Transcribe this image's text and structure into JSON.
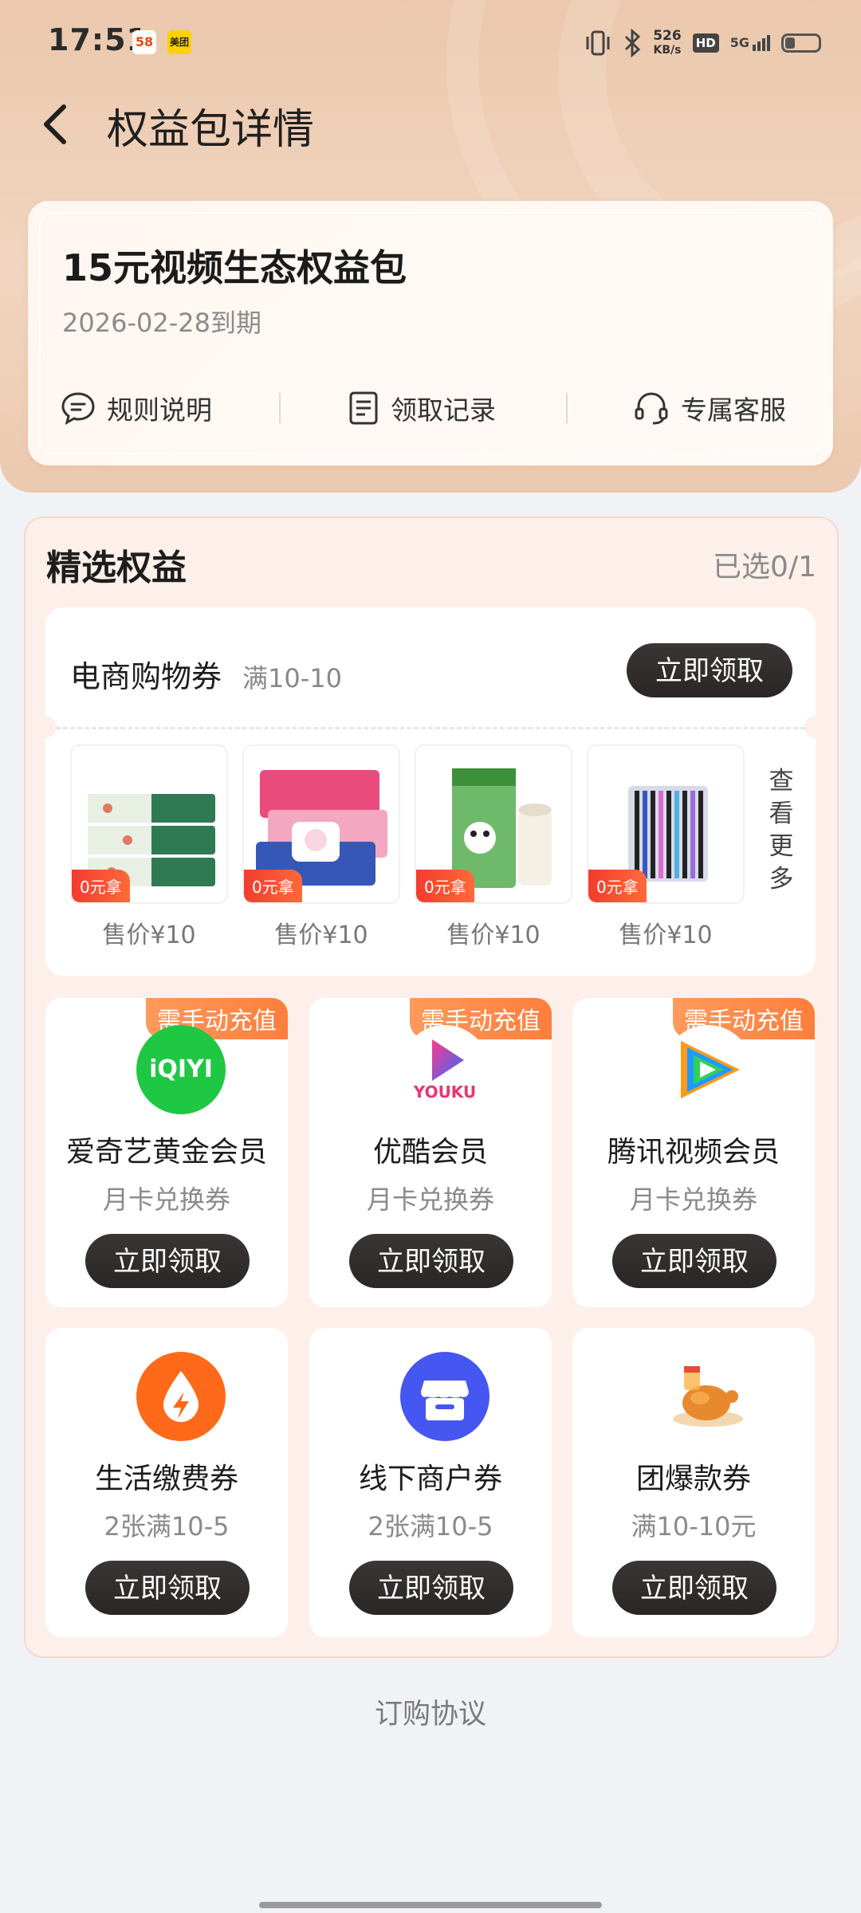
{
  "status_bar": {
    "time": "17:51",
    "app_58": "58",
    "app_meituan": "美团",
    "net_speed_value": "526",
    "net_speed_unit": "KB/s",
    "hd": "HD",
    "signal": "5G",
    "battery_level": 0.3
  },
  "header": {
    "title": "权益包详情"
  },
  "package": {
    "name": "15元视频生态权益包",
    "expiry": "2026-02-28到期",
    "actions": [
      "规则说明",
      "领取记录",
      "专属客服"
    ]
  },
  "selected": {
    "title": "精选权益",
    "count": "已选0/1"
  },
  "ecommerce": {
    "title": "电商购物券",
    "condition": "满10-10",
    "button": "立即领取",
    "products": [
      {
        "tag": "0元拿",
        "price": "售价¥10"
      },
      {
        "tag": "0元拿",
        "price": "售价¥10"
      },
      {
        "tag": "0元拿",
        "price": "售价¥10"
      },
      {
        "tag": "0元拿",
        "price": "售价¥10"
      }
    ],
    "more": "查看更多"
  },
  "benefits": [
    {
      "badge": "需手动充值",
      "name": "爱奇艺黄金会员",
      "sub": "月卡兑换券",
      "button": "立即领取",
      "logo_text": "iQIYI"
    },
    {
      "badge": "需手动充值",
      "name": "优酷会员",
      "sub": "月卡兑换券",
      "button": "立即领取",
      "logo_text": "YOUKU"
    },
    {
      "badge": "需手动充值",
      "name": "腾讯视频会员",
      "sub": "月卡兑换券",
      "button": "立即领取",
      "logo_text": ""
    },
    {
      "badge": "",
      "name": "生活缴费券",
      "sub": "2张满10-5",
      "button": "立即领取",
      "logo_text": ""
    },
    {
      "badge": "",
      "name": "线下商户券",
      "sub": "2张满10-5",
      "button": "立即领取",
      "logo_text": ""
    },
    {
      "badge": "",
      "name": "团爆款券",
      "sub": "满10-10元",
      "button": "立即领取",
      "logo_text": ""
    }
  ],
  "footer": {
    "agreement": "订购协议"
  },
  "colors": {
    "accent_dark": "#2e2a2a",
    "badge_orange": "#ff8a4a",
    "iqiyi_green": "#1ec843",
    "bill_orange": "#ff6a1a",
    "store_blue": "#4656f0",
    "tag_red": "#f23c2f"
  }
}
